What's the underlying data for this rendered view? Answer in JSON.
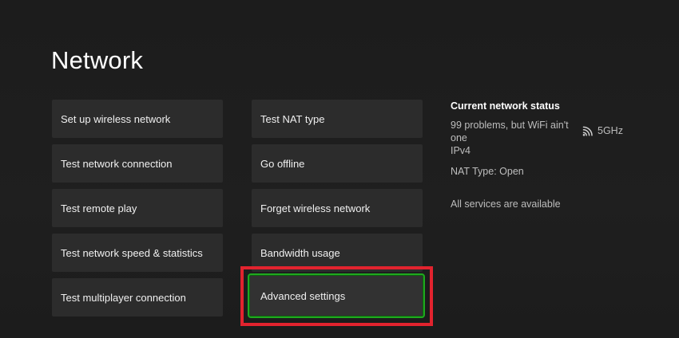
{
  "page": {
    "title": "Network"
  },
  "menu": {
    "left_column": [
      {
        "label": "Set up wireless network"
      },
      {
        "label": "Test network connection"
      },
      {
        "label": "Test remote play"
      },
      {
        "label": "Test network speed & statistics"
      },
      {
        "label": "Test multiplayer connection"
      }
    ],
    "right_column": [
      {
        "label": "Test NAT type"
      },
      {
        "label": "Go offline"
      },
      {
        "label": "Forget wireless network"
      },
      {
        "label": "Bandwidth usage"
      },
      {
        "label": "Advanced settings",
        "focused": true
      }
    ]
  },
  "status": {
    "heading": "Current network status",
    "network_name": "99 problems, but WiFi ain't one",
    "band": "5GHz",
    "band_icon": "wifi-signal-icon",
    "protocol": "IPv4",
    "nat_type": "NAT Type: Open",
    "services": "All services are available"
  },
  "colors": {
    "background": "#1e1e1e",
    "tile": "#2c2c2c",
    "focus_border": "#1fa91f",
    "annotation_box": "#e2232e",
    "secondary_text": "#bdbdbd"
  }
}
